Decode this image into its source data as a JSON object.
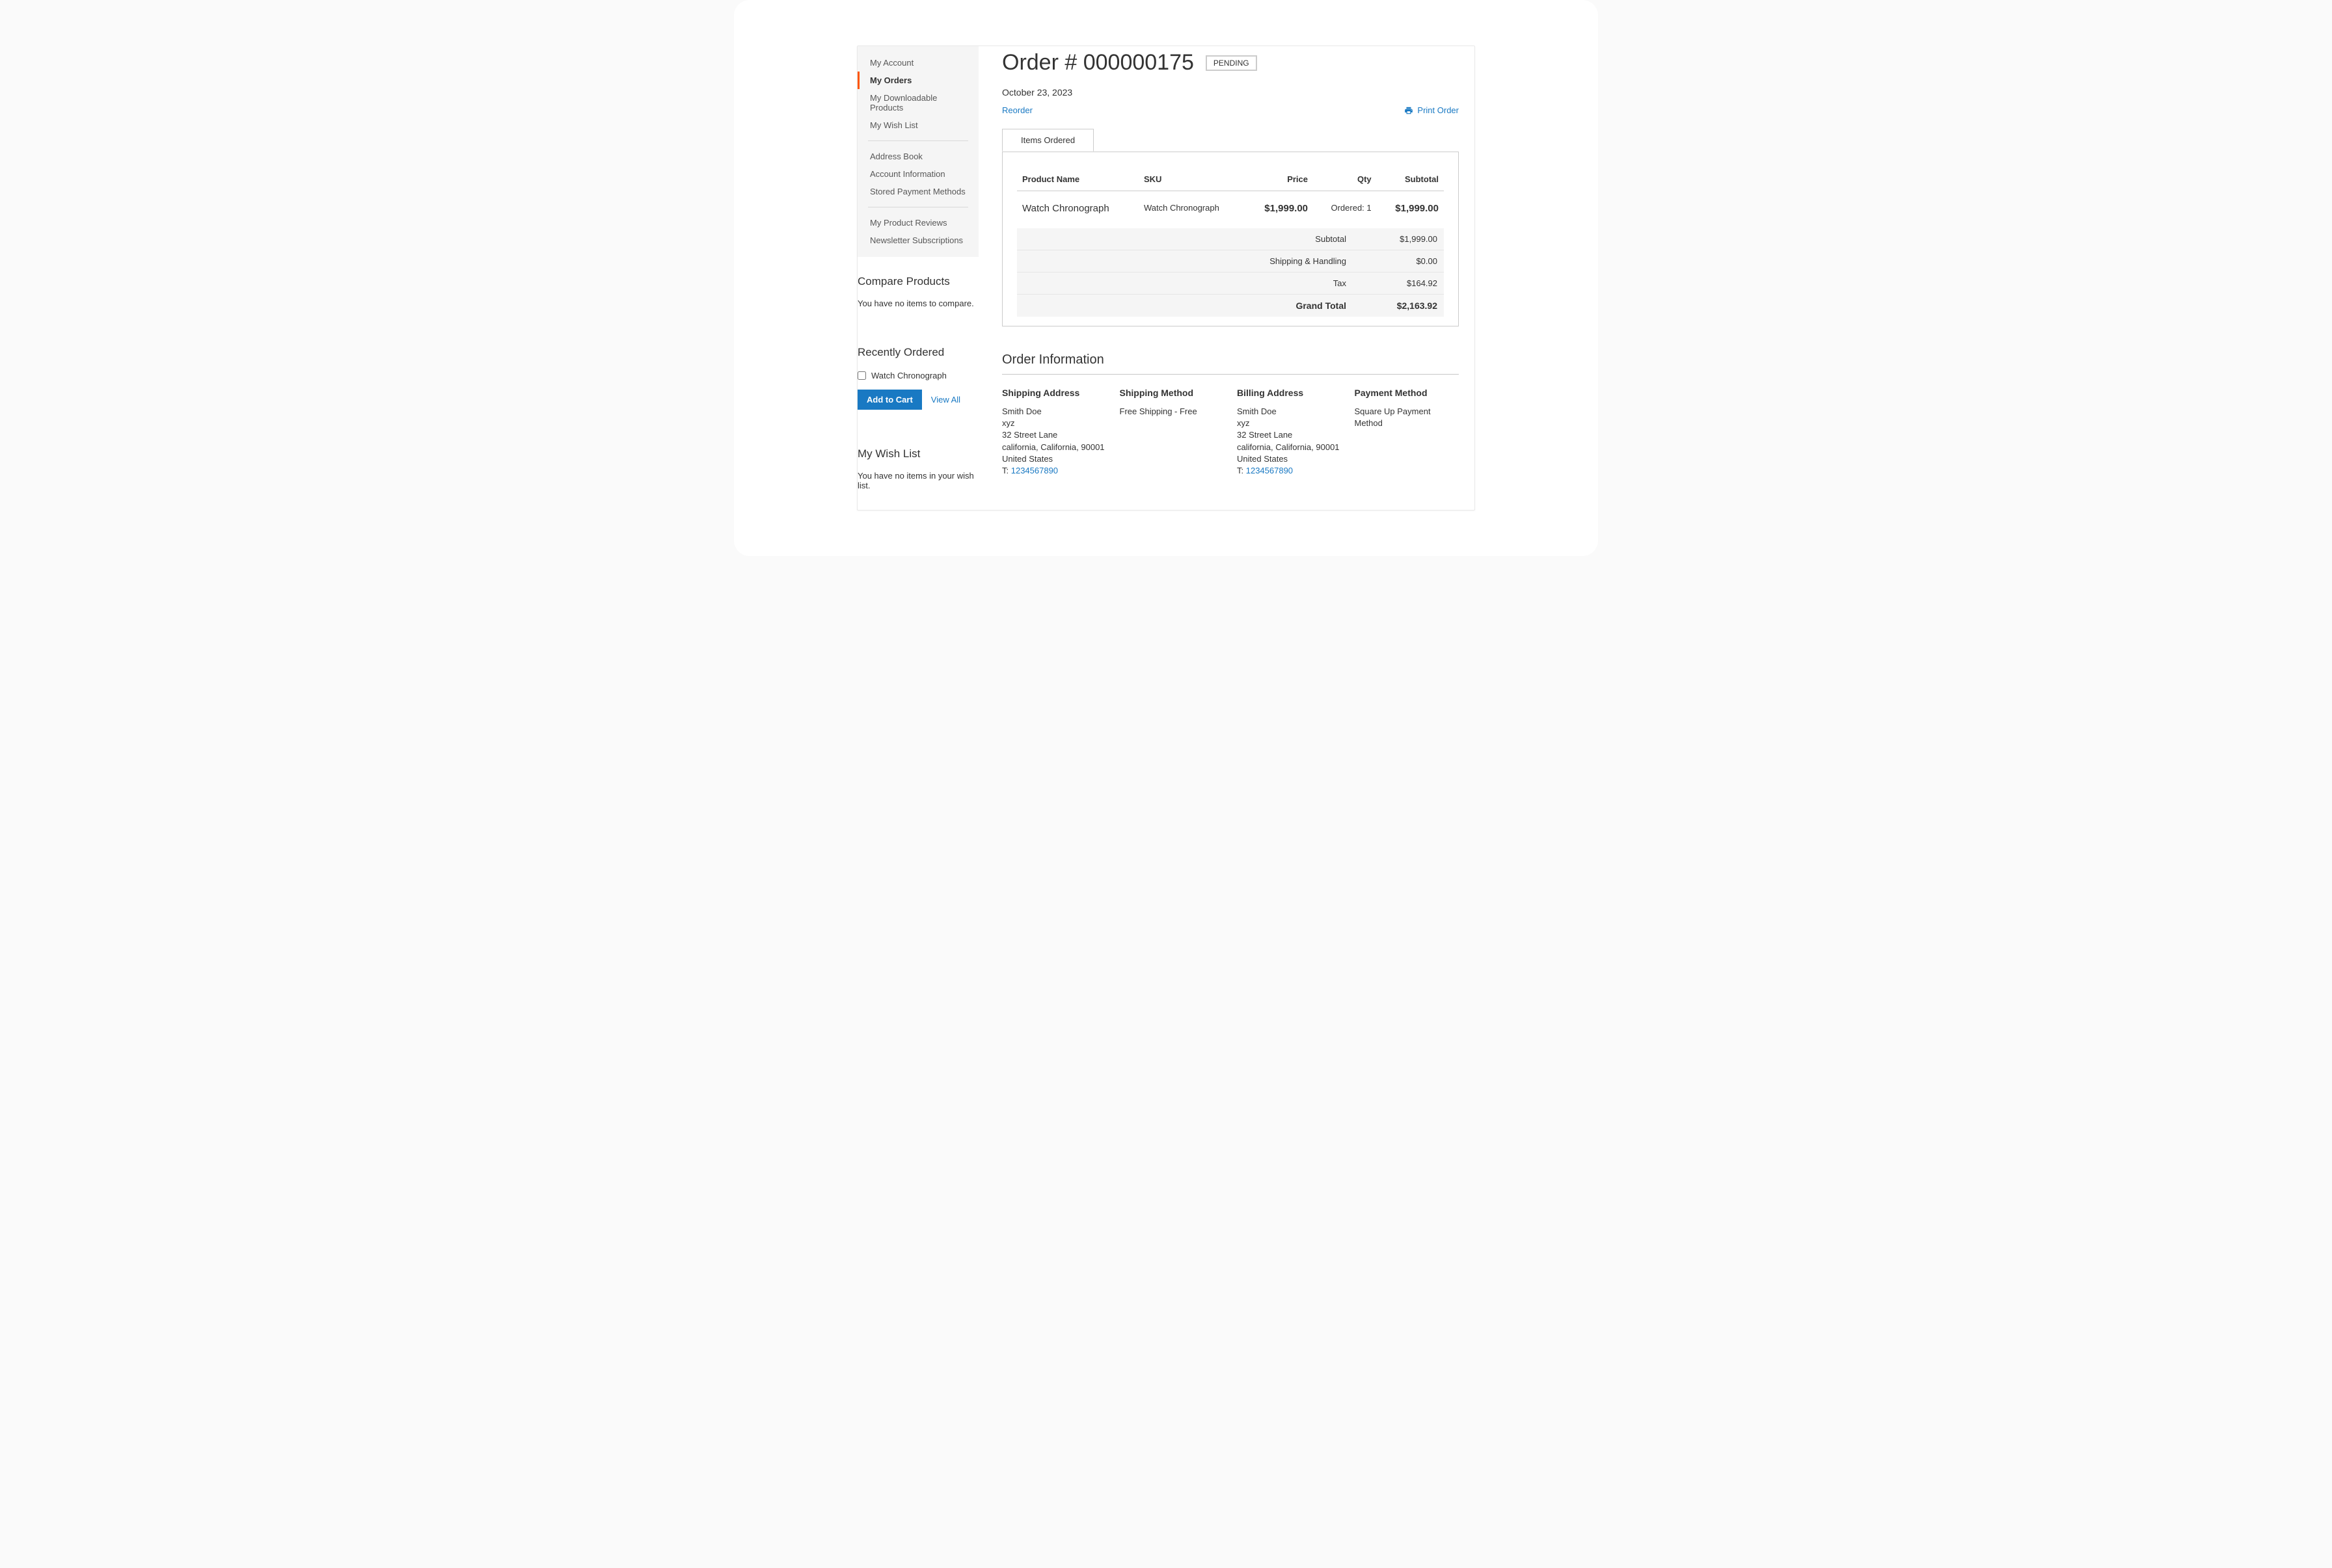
{
  "sidebar": {
    "nav": [
      {
        "label": "My Account"
      },
      {
        "label": "My Orders",
        "active": true
      },
      {
        "label": "My Downloadable Products"
      },
      {
        "label": "My Wish List"
      }
    ],
    "nav2": [
      {
        "label": "Address Book"
      },
      {
        "label": "Account Information"
      },
      {
        "label": "Stored Payment Methods"
      }
    ],
    "nav3": [
      {
        "label": "My Product Reviews"
      },
      {
        "label": "Newsletter Subscriptions"
      }
    ],
    "compare": {
      "title": "Compare Products",
      "empty": "You have no items to compare."
    },
    "recent": {
      "title": "Recently Ordered",
      "item": "Watch Chronograph",
      "add_to_cart": "Add to Cart",
      "view_all": "View All"
    },
    "wishlist": {
      "title": "My Wish List",
      "empty": "You have no items in your wish list."
    }
  },
  "order": {
    "title": "Order # 000000175",
    "status": "PENDING",
    "date": "October 23, 2023",
    "reorder": "Reorder",
    "print": "Print Order",
    "tab": "Items Ordered",
    "columns": {
      "product": "Product Name",
      "sku": "SKU",
      "price": "Price",
      "qty": "Qty",
      "subtotal": "Subtotal"
    },
    "item": {
      "name": "Watch Chronograph",
      "sku": "Watch Chronograph",
      "price": "$1,999.00",
      "qty": "Ordered: 1",
      "subtotal": "$1,999.00"
    },
    "totals": {
      "subtotal_label": "Subtotal",
      "subtotal": "$1,999.00",
      "shipping_label": "Shipping & Handling",
      "shipping": "$0.00",
      "tax_label": "Tax",
      "tax": "$164.92",
      "grand_label": "Grand Total",
      "grand": "$2,163.92"
    }
  },
  "info": {
    "title": "Order Information",
    "shipping_address": {
      "title": "Shipping Address",
      "name": "Smith Doe",
      "company": "xyz",
      "street": "32 Street Lane",
      "city": "california, California, 90001",
      "country": "United States",
      "phone_label": "T: ",
      "phone": "1234567890"
    },
    "shipping_method": {
      "title": "Shipping Method",
      "value": "Free Shipping - Free"
    },
    "billing_address": {
      "title": "Billing Address",
      "name": "Smith Doe",
      "company": "xyz",
      "street": "32 Street Lane",
      "city": "california, California, 90001",
      "country": "United States",
      "phone_label": "T: ",
      "phone": "1234567890"
    },
    "payment_method": {
      "title": "Payment Method",
      "value": "Square Up Payment Method"
    }
  }
}
